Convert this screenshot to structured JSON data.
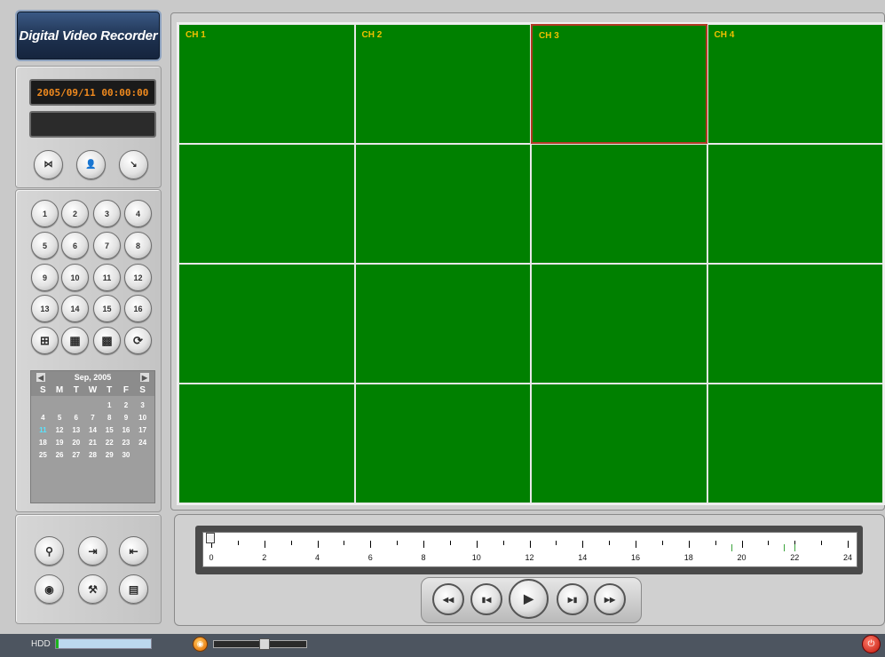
{
  "app": {
    "title": "Digital Video Recorder"
  },
  "display": {
    "datetime": "2005/09/11 00:00:00",
    "secondary": ""
  },
  "mode_buttons": [
    {
      "name": "audio-mode-icon",
      "glyph": "⋈"
    },
    {
      "name": "user-icon",
      "glyph": "👤"
    },
    {
      "name": "camera-control-icon",
      "glyph": "↘"
    }
  ],
  "channels": [
    "1",
    "2",
    "3",
    "4",
    "5",
    "6",
    "7",
    "8",
    "9",
    "10",
    "11",
    "12",
    "13",
    "14",
    "15",
    "16"
  ],
  "layout_buttons": [
    {
      "name": "layout-2x2-icon",
      "glyph": "⊞"
    },
    {
      "name": "layout-3x3-icon",
      "glyph": "▦"
    },
    {
      "name": "layout-4x4-icon",
      "glyph": "▩"
    },
    {
      "name": "sequence-icon",
      "glyph": "⟳"
    }
  ],
  "calendar": {
    "month_label": "Sep, 2005",
    "weekdays": [
      "S",
      "M",
      "T",
      "W",
      "T",
      "F",
      "S"
    ],
    "first_weekday": 4,
    "days_in_month": 30,
    "today": 11
  },
  "video": {
    "channel_labels": [
      "CH 1",
      "CH 2",
      "CH 3",
      "CH 4"
    ],
    "selected_channel": "CH 3",
    "grid_rows": 4,
    "grid_cols": 4,
    "background_color": "#008000",
    "label_color": "#f0c000"
  },
  "timeline": {
    "labels": [
      "0",
      "2",
      "4",
      "6",
      "8",
      "10",
      "12",
      "14",
      "16",
      "18",
      "20",
      "22",
      "24"
    ],
    "position_hour": 0,
    "recorded_marks_hours": [
      19.6,
      21.6,
      22.0
    ]
  },
  "playback_buttons": [
    {
      "name": "fast-rewind-icon",
      "glyph": "◀◀"
    },
    {
      "name": "step-back-icon",
      "glyph": "▮◀"
    },
    {
      "name": "play-icon",
      "glyph": "▶"
    },
    {
      "name": "step-forward-icon",
      "glyph": "▶▮"
    },
    {
      "name": "fast-forward-icon",
      "glyph": "▶▶"
    }
  ],
  "tool_buttons": [
    {
      "name": "search-icon",
      "glyph": "⚲"
    },
    {
      "name": "log-in-icon",
      "glyph": "⇥"
    },
    {
      "name": "log-out-icon",
      "glyph": "⇤"
    },
    {
      "name": "backup-icon",
      "glyph": "◉"
    },
    {
      "name": "setup-icon",
      "glyph": "⚒"
    },
    {
      "name": "print-icon",
      "glyph": "▤"
    }
  ],
  "status": {
    "hdd_label": "HDD",
    "hdd_usage_fraction": 0.03,
    "volume_fraction": 0.55
  }
}
